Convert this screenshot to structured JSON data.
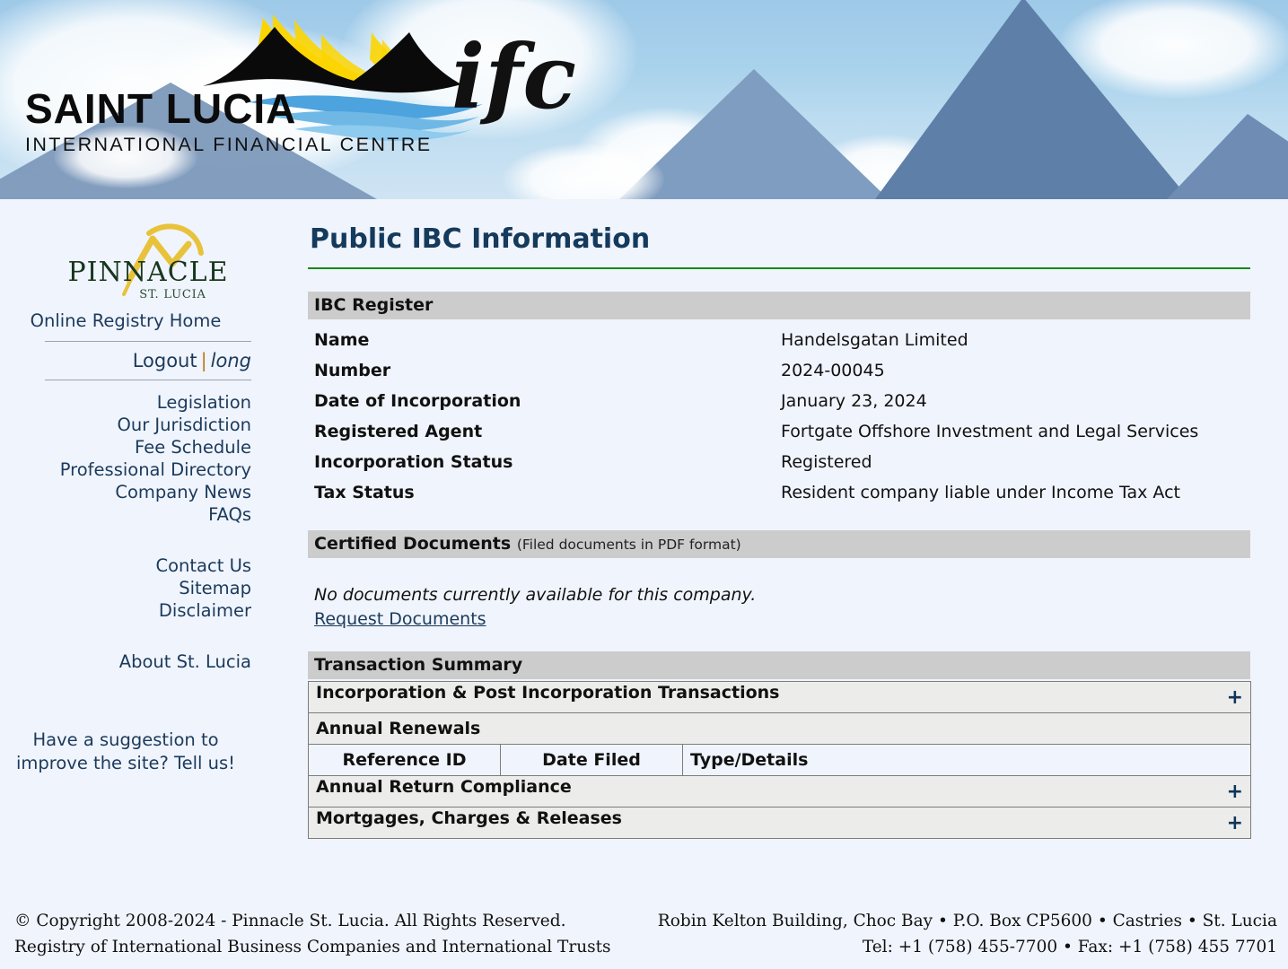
{
  "banner": {
    "org_line1": "SAINT LUCIA",
    "org_line2": "INTERNATIONAL FINANCIAL CENTRE",
    "ifc_mark": "ifc",
    "logo_icon": "saint-lucia-ifc-logo"
  },
  "sidebar": {
    "logo_word": "PINNACLE",
    "logo_sub": "ST. LUCIA",
    "home_label": "Online Registry Home",
    "logout_label": "Logout",
    "logout_separator": "|",
    "username": "long",
    "nav_group_1": [
      {
        "label": "Legislation"
      },
      {
        "label": "Our Jurisdiction"
      },
      {
        "label": "Fee Schedule"
      },
      {
        "label": "Professional Directory"
      },
      {
        "label": "Company News"
      },
      {
        "label": "FAQs"
      }
    ],
    "nav_group_2": [
      {
        "label": "Contact Us"
      },
      {
        "label": "Sitemap"
      },
      {
        "label": "Disclaimer"
      }
    ],
    "nav_group_3": [
      {
        "label": "About St. Lucia"
      }
    ],
    "suggestion_line1": "Have a suggestion to",
    "suggestion_line2": "improve the site? Tell us!"
  },
  "main": {
    "page_title": "Public IBC Information",
    "register": {
      "section_title": "IBC Register",
      "rows": [
        {
          "label": "Name",
          "value": "Handelsgatan Limited"
        },
        {
          "label": "Number",
          "value": "2024-00045"
        },
        {
          "label": "Date of Incorporation",
          "value": "January 23, 2024"
        },
        {
          "label": "Registered Agent",
          "value": "Fortgate Offshore Investment and Legal Services"
        },
        {
          "label": "Incorporation Status",
          "value": "Registered"
        },
        {
          "label": "Tax Status",
          "value": "Resident company liable under Income Tax Act"
        }
      ]
    },
    "documents": {
      "section_title": "Certified Documents",
      "section_subtitle": "(Filed documents in PDF format)",
      "empty_message": "No documents currently available for this company.",
      "request_link": "Request Documents"
    },
    "transactions": {
      "section_title": "Transaction Summary",
      "expand_glyph": "+",
      "columns": [
        "Reference ID",
        "Date Filed",
        "Type/Details"
      ],
      "groups": [
        {
          "label": "Incorporation & Post Incorporation Transactions",
          "expandable": true
        },
        {
          "label": "Annual Renewals",
          "expandable": false
        },
        {
          "label": "Annual Return Compliance",
          "expandable": true
        },
        {
          "label": "Mortgages, Charges & Releases",
          "expandable": true
        }
      ]
    }
  },
  "footer": {
    "copyright_line1": "© Copyright 2008-2024 - Pinnacle St. Lucia. All Rights Reserved.",
    "copyright_line2": "Registry of International Business Companies and International Trusts",
    "address_line1": "Robin Kelton Building, Choc Bay • P.O. Box CP5600 • Castries • St. Lucia",
    "address_line2": "Tel: +1 (758) 455-7700 • Fax: +1 (758) 455 7701"
  },
  "colors": {
    "page_bg": "#f0f4fc",
    "title_blue": "#143a5c",
    "rule_green": "#138a13",
    "section_gray": "#cccccc",
    "row_gray": "#ececea",
    "link_blue": "#1b3a5c",
    "accent_orange": "#c07a1e"
  }
}
